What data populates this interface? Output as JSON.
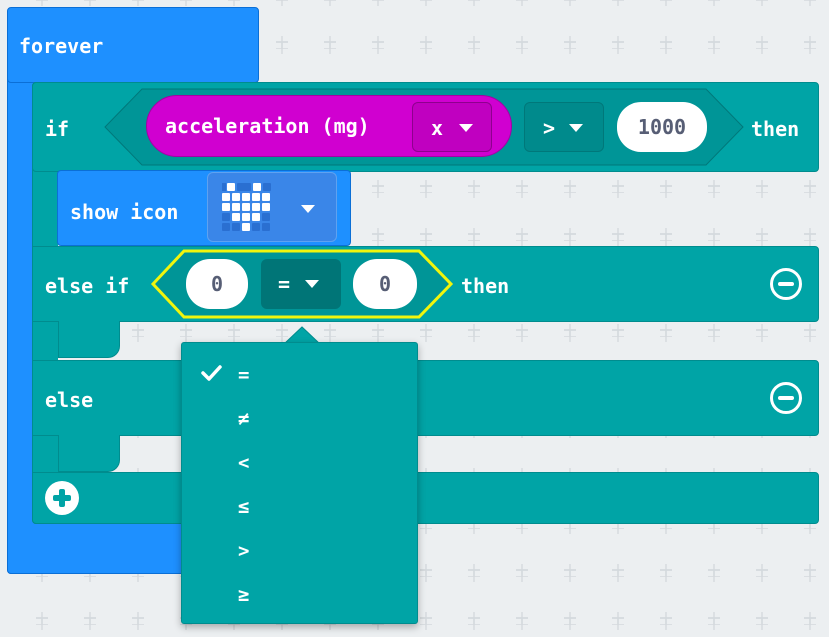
{
  "blocks": {
    "forever": {
      "label": "forever"
    },
    "if_block": {
      "if_label": "if",
      "then_label": "then",
      "condition": {
        "sensor_label": "acceleration (mg)",
        "axis_value": "x",
        "operator": ">",
        "value": "1000"
      }
    },
    "show_icon": {
      "label": "show icon",
      "icon": "heart-icon"
    },
    "else_if": {
      "label": "else if",
      "then_label": "then",
      "left_value": "0",
      "operator": "=",
      "right_value": "0"
    },
    "else": {
      "label": "else"
    }
  },
  "dropdown": {
    "selected": "=",
    "options": [
      "=",
      "≠",
      "<",
      "≤",
      ">",
      "≥"
    ]
  },
  "colors": {
    "workspace": "#eceff1",
    "basic_blue": "#1e90ff",
    "logic_teal": "#00a4a6",
    "input_magenta": "#d000d0",
    "selection_yellow": "#f1f50d"
  }
}
